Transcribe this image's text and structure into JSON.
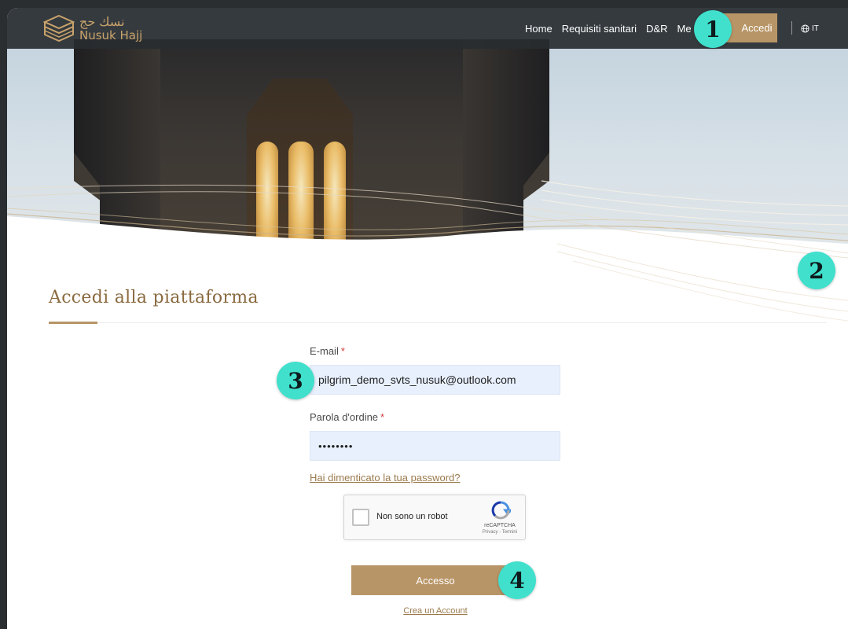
{
  "nav": {
    "logo_arabic": "نسك حج",
    "logo_english": "Nusuk Hajj",
    "links": [
      "Home",
      "Requisiti sanitari",
      "D&R",
      "Me"
    ],
    "login_label": "Accedi",
    "language": "IT"
  },
  "login": {
    "title": "Accedi alla piattaforma",
    "email_label": "E-mail",
    "email_value": "pilgrim_demo_svts_nusuk@outlook.com",
    "password_label": "Parola d'ordine",
    "password_value": "••••••••",
    "required_mark": "*",
    "forgot_label": "Hai dimenticato la tua password?",
    "captcha_label": "Non sono un robot",
    "captcha_brand": "reCAPTCHA",
    "captcha_links": "Privacy - Termini",
    "submit_label": "Accesso",
    "create_account_label": "Crea un Account"
  },
  "badges": [
    "1",
    "2",
    "3",
    "4"
  ],
  "colors": {
    "accent_gold": "#b89566",
    "badge_teal": "#40e0cc",
    "nav_bg": "#282c30",
    "input_bg": "#e8f0fe"
  },
  "icons": {
    "logo": "kaaba-logo-icon",
    "language": "globe-icon",
    "captcha": "recaptcha-icon"
  }
}
